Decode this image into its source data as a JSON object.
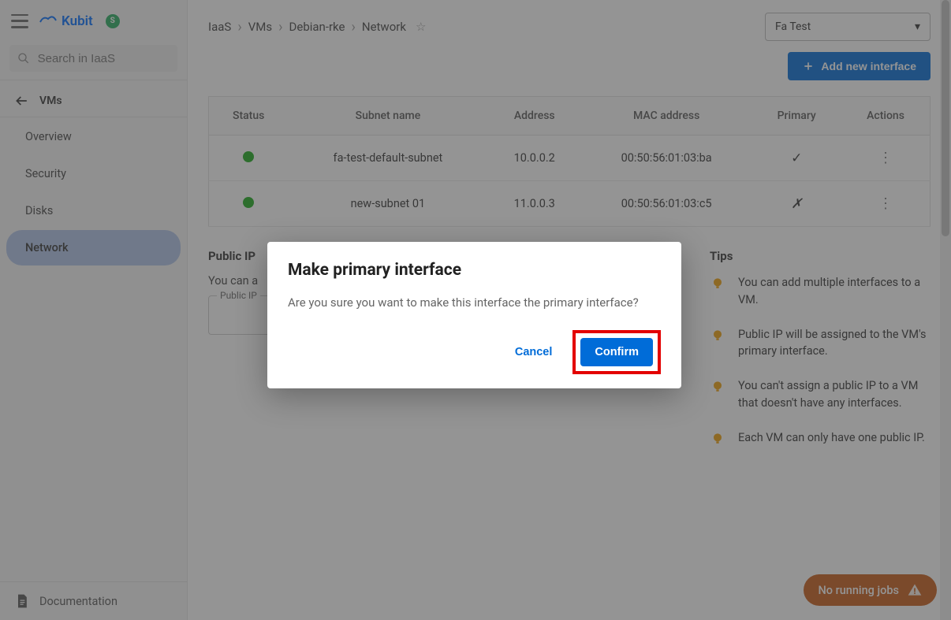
{
  "brand": {
    "name": "Kubit"
  },
  "search": {
    "placeholder": "Search in IaaS"
  },
  "sidebar": {
    "back_label": "VMs",
    "items": [
      {
        "label": "Overview"
      },
      {
        "label": "Security"
      },
      {
        "label": "Disks"
      },
      {
        "label": "Network"
      }
    ],
    "active_index": 3,
    "footer": "Documentation"
  },
  "breadcrumb": [
    "IaaS",
    "VMs",
    "Debian-rke",
    "Network"
  ],
  "project": "Fa Test",
  "add_button": "Add new interface",
  "table": {
    "headers": [
      "Status",
      "Subnet name",
      "Address",
      "MAC address",
      "Primary",
      "Actions"
    ],
    "rows": [
      {
        "subnet": "fa-test-default-subnet",
        "address": "10.0.0.2",
        "mac": "00:50:56:01:03:ba",
        "primary": true
      },
      {
        "subnet": "new-subnet 01",
        "address": "11.0.0.3",
        "mac": "00:50:56:01:03:c5",
        "primary": false
      }
    ]
  },
  "public_ip": {
    "title": "Public IP",
    "desc": "You can a",
    "field_label": "Public IP"
  },
  "tips": {
    "title": "Tips",
    "items": [
      "You can add multiple interfaces to a VM.",
      "Public IP will be assigned to the VM's primary interface.",
      "You can't assign a public IP to a VM that doesn't have any interfaces.",
      "Each VM can only have one public IP."
    ]
  },
  "dialog": {
    "title": "Make primary interface",
    "body": "Are you sure you want to make this interface the primary interface?",
    "cancel": "Cancel",
    "confirm": "Confirm"
  },
  "jobs": "No running jobs"
}
